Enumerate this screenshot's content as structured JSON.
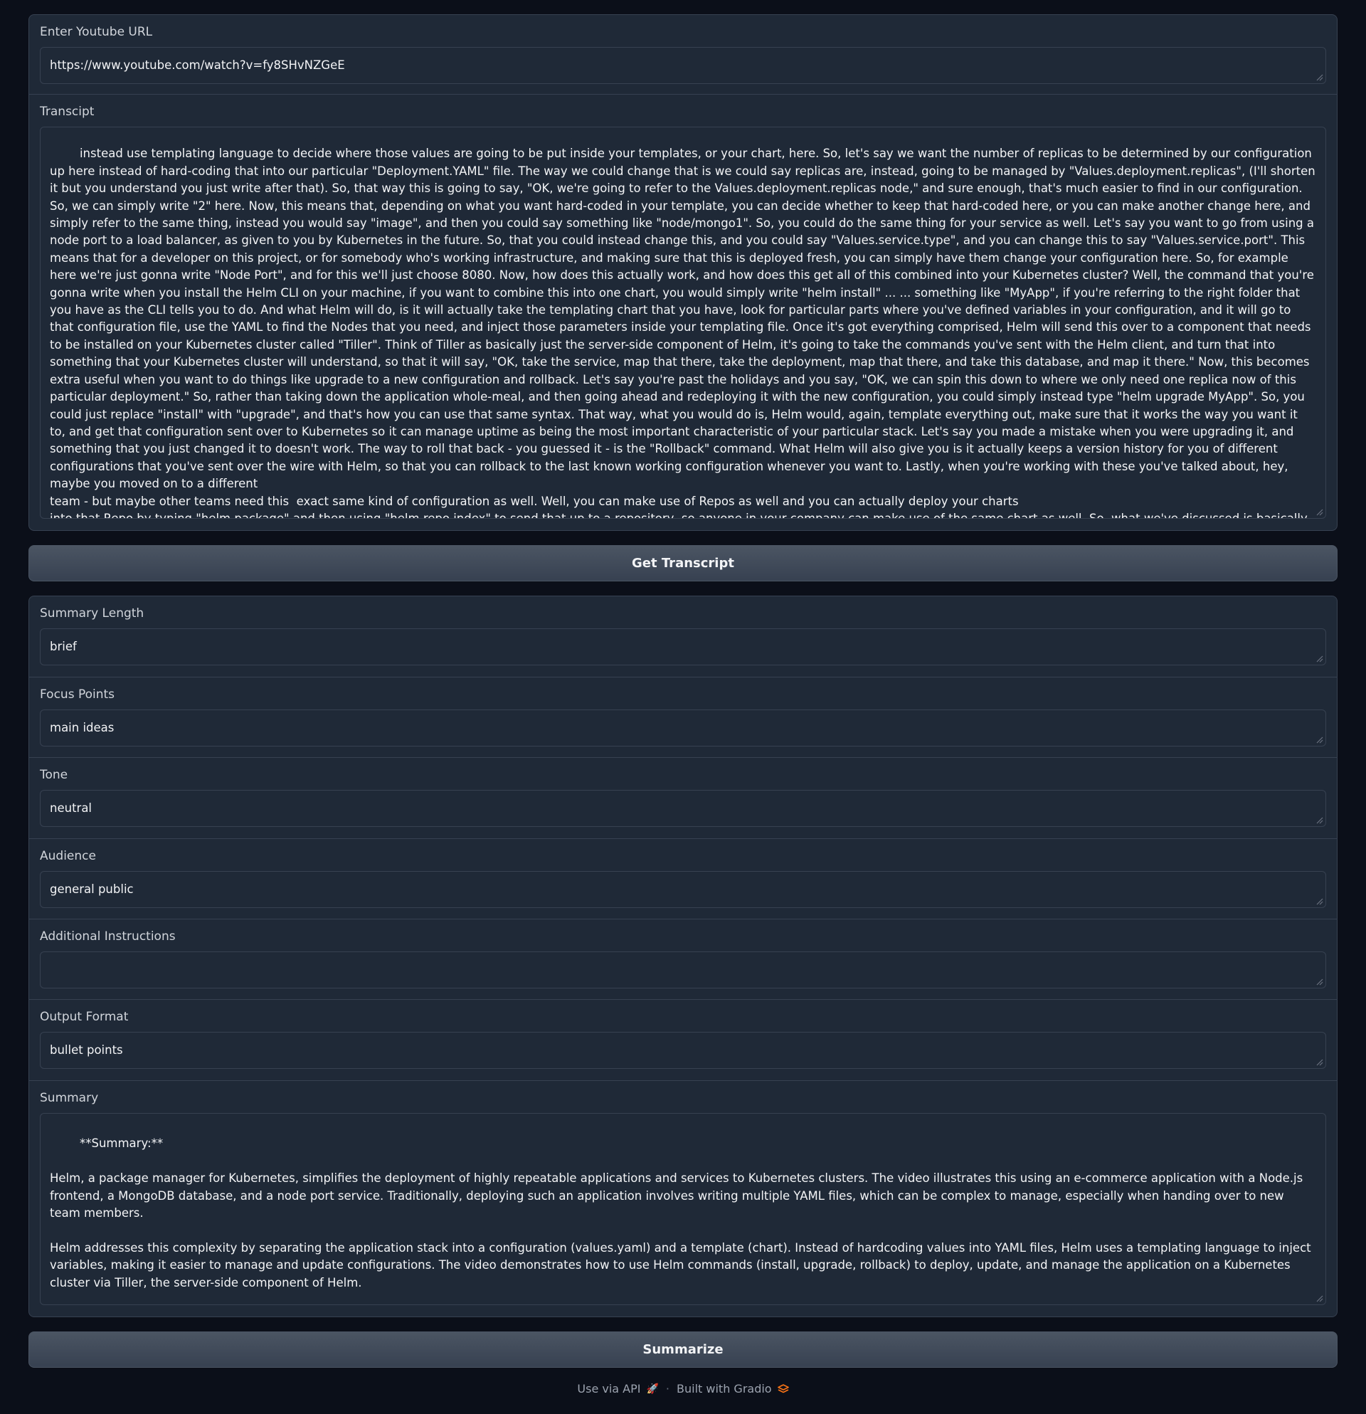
{
  "youtube": {
    "label": "Enter Youtube URL",
    "value": "https://www.youtube.com/watch?v=fy8SHvNZGeE"
  },
  "transcript": {
    "label": "Transcipt",
    "value": "instead use templating language to decide where those values are going to be put inside your templates, or your chart, here. So, let's say we want the number of replicas to be determined by our configuration up here instead of hard-coding that into our particular \"Deployment.YAML\" file. The way we could change that is we could say replicas are, instead, going to be managed by \"Values.deployment.replicas\", (I'll shorten it but you understand you just write after that). So, that way this is going to say, \"OK, we're going to refer to the Values.deployment.replicas node,\" and sure enough, that's much easier to find in our configuration. So, we can simply write \"2\" here. Now, this means that, depending on what you want hard-coded in your template, you can decide whether to keep that hard-coded here, or you can make another change here, and simply refer to the same thing, instead you would say \"image\", and then you could say something like \"node/mongo1\". So, you could do the same thing for your service as well. Let's say you want to go from using a node port to a load balancer, as given to you by Kubernetes in the future. So, that you could instead change this, and you could say \"Values.service.type\", and you can change this to say \"Values.service.port\". This means that for a developer on this project, or for somebody who's working infrastructure, and making sure that this is deployed fresh, you can simply have them change your configuration here. So, for example here we're just gonna write \"Node Port\", and for this we'll just choose 8080. Now, how does this actually work, and how does this get all of this combined into your Kubernetes cluster? Well, the command that you're gonna write when you install the Helm CLI on your machine, if you want to combine this into one chart, you would simply write \"helm install\" ... ... something like \"MyApp\", if you're referring to the right folder that you have as the CLI tells you to do. And what Helm will do, is it will actually take the templating chart that you have, look for particular parts where you've defined variables in your configuration, and it will go to that configuration file, use the YAML to find the Nodes that you need, and inject those parameters inside your templating file. Once it's got everything comprised, Helm will send this over to a component that needs to be installed on your Kubernetes cluster called \"Tiller\". Think of Tiller as basically just the server-side component of Helm, it's going to take the commands you've sent with the Helm client, and turn that into something that your Kubernetes cluster will understand, so that it will say, \"OK, take the service, map that there, take the deployment, map that there, and take this database, and map it there.\" Now, this becomes extra useful when you want to do things like upgrade to a new configuration and rollback. Let's say you're past the holidays and you say, \"OK, we can spin this down to where we only need one replica now of this particular deployment.\" So, rather than taking down the application whole-meal, and then going ahead and redeploying it with the new configuration, you could simply instead type \"helm upgrade MyApp\". So, you could just replace \"install\" with \"upgrade\", and that's how you can use that same syntax. That way, what you would do is, Helm would, again, template everything out, make sure that it works the way you want it to, and get that configuration sent over to Kubernetes so it can manage uptime as being the most important characteristic of your particular stack. Let's say you made a mistake when you were upgrading it, and something that you just changed it to doesn't work. The way to roll that back - you guessed it - is the \"Rollback\" command. What Helm will also give you is it actually keeps a version history for you of different configurations that you've sent over the wire with Helm, so that you can rollback to the last known working configuration whenever you want to. Lastly, when you're working with these you've talked about, hey, maybe you moved on to a different\nteam - but maybe other teams need this  exact same kind of configuration as well. Well, you can make use of Repos as well and you can actually deploy your charts\ninto that Repo by typing \"helm package\" and then using \"helm repo index\" to send that up to a repository, so anyone in your company can make use of the same chart as well. So, what we've discussed is basically taking a typical scenario, going through it in a fairly understandable way by hard coding your YAML, but, by parameterizing it with Helm, you just make it a little bit easier to manage these packages, and upgrade them when you need to, and make it easier for everyone else on your team to understand it as well. It's currently in the incubation phase of the Cloud-Native Computing Foundation and it's ready for open source, and ready for you to use today. Thank you. If you have questions please drop us a line below. If you want to see more videos like this in the future, please \"like\" and subscribe, and don't forget, you can always get started on the cloud at no cost by signing up for a free IBM Cloud account."
  },
  "buttons": {
    "get_transcript": "Get Transcript",
    "summarize": "Summarize"
  },
  "summary_length": {
    "label": "Summary Length",
    "value": "brief"
  },
  "focus_points": {
    "label": "Focus Points",
    "value": "main ideas"
  },
  "tone": {
    "label": "Tone",
    "value": "neutral"
  },
  "audience": {
    "label": "Audience",
    "value": "general public"
  },
  "additional_instructions": {
    "label": "Additional Instructions",
    "value": ""
  },
  "output_format": {
    "label": "Output Format",
    "value": "bullet points"
  },
  "summary": {
    "label": "Summary",
    "value": "**Summary:**\n\nHelm, a package manager for Kubernetes, simplifies the deployment of highly repeatable applications and services to Kubernetes clusters. The video illustrates this using an e-commerce application with a Node.js frontend, a MongoDB database, and a node port service. Traditionally, deploying such an application involves writing multiple YAML files, which can be complex to manage, especially when handing over to new team members.\n\nHelm addresses this complexity by separating the application stack into a configuration (values.yaml) and a template (chart). Instead of hardcoding values into YAML files, Helm uses a templating language to inject variables, making it easier to manage and update configurations. The video demonstrates how to use Helm commands (install, upgrade, rollback) to deploy, update, and manage the application on a Kubernetes cluster via Tiller, the server-side component of Helm.\n\nAdditionally, Helm keeps a version history of configurations, allowing for rollbacks to previous working versions. Teams can also share and reuse Helm charts through repositories. Overall, Helm streamlines Kubernetes application deployment and management, making it more accessible and efficient."
  },
  "footer": {
    "api_text": "Use via API",
    "api_icon": "rocket-icon",
    "separator": "·",
    "built_text": "Built with Gradio",
    "gradio_icon": "gradio-logo-icon"
  },
  "colors": {
    "background": "#0b0f19",
    "panel": "#1f2937",
    "border": "#374151",
    "button": "#4b5563",
    "accent": "#f97316"
  }
}
